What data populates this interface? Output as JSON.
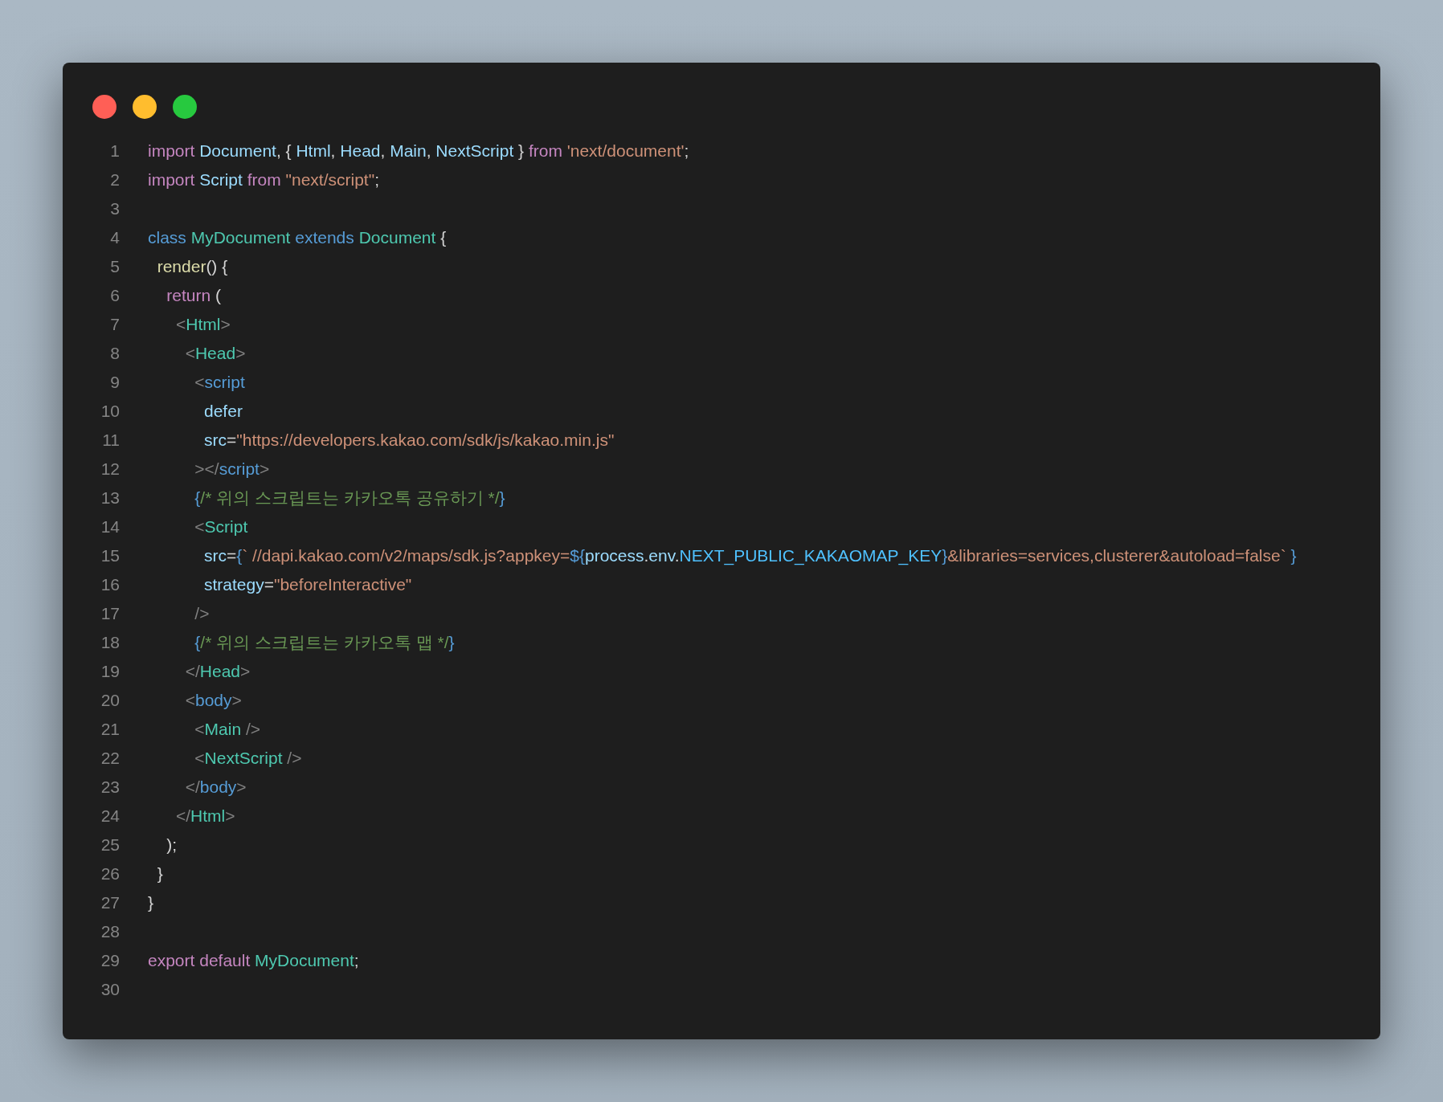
{
  "window": {
    "controls": [
      {
        "kind": "close"
      },
      {
        "kind": "minimize"
      },
      {
        "kind": "zoom"
      }
    ]
  },
  "lines": [
    {
      "number": "1",
      "tokens": [
        {
          "text": "import ",
          "kind": "keyword"
        },
        {
          "text": "Document",
          "kind": "ident"
        },
        {
          "text": ", { ",
          "kind": "plain"
        },
        {
          "text": "Html",
          "kind": "ident"
        },
        {
          "text": ", ",
          "kind": "plain"
        },
        {
          "text": "Head",
          "kind": "ident"
        },
        {
          "text": ", ",
          "kind": "plain"
        },
        {
          "text": "Main",
          "kind": "ident"
        },
        {
          "text": ", ",
          "kind": "plain"
        },
        {
          "text": "NextScript",
          "kind": "ident"
        },
        {
          "text": " } ",
          "kind": "plain"
        },
        {
          "text": "from ",
          "kind": "keyword"
        },
        {
          "text": "'next/document'",
          "kind": "string"
        },
        {
          "text": ";",
          "kind": "plain"
        }
      ]
    },
    {
      "number": "2",
      "tokens": [
        {
          "text": "import ",
          "kind": "keyword"
        },
        {
          "text": "Script ",
          "kind": "ident"
        },
        {
          "text": "from ",
          "kind": "keyword"
        },
        {
          "text": "\"next/script\"",
          "kind": "string"
        },
        {
          "text": ";",
          "kind": "plain"
        }
      ]
    },
    {
      "number": "3"
    },
    {
      "number": "4",
      "tokens": [
        {
          "text": "class ",
          "kind": "storage"
        },
        {
          "text": "MyDocument ",
          "kind": "type"
        },
        {
          "text": "extends ",
          "kind": "storage"
        },
        {
          "text": "Document ",
          "kind": "type"
        },
        {
          "text": "{",
          "kind": "plain"
        }
      ]
    },
    {
      "number": "5",
      "tokens": [
        {
          "text": "  render",
          "kind": "function"
        },
        {
          "text": "() {",
          "kind": "plain"
        }
      ]
    },
    {
      "number": "6",
      "tokens": [
        {
          "text": "    return ",
          "kind": "keyword"
        },
        {
          "text": "(",
          "kind": "plain"
        }
      ]
    },
    {
      "number": "7",
      "tokens": [
        {
          "text": "      <",
          "kind": "punct"
        },
        {
          "text": "Html",
          "kind": "type"
        },
        {
          "text": ">",
          "kind": "punct"
        }
      ]
    },
    {
      "number": "8",
      "tokens": [
        {
          "text": "        <",
          "kind": "punct"
        },
        {
          "text": "Head",
          "kind": "type"
        },
        {
          "text": ">",
          "kind": "punct"
        }
      ]
    },
    {
      "number": "9",
      "tokens": [
        {
          "text": "          <",
          "kind": "punct"
        },
        {
          "text": "script",
          "kind": "storage"
        }
      ]
    },
    {
      "number": "10",
      "tokens": [
        {
          "text": "            defer",
          "kind": "ident"
        }
      ]
    },
    {
      "number": "11",
      "tokens": [
        {
          "text": "            src",
          "kind": "ident"
        },
        {
          "text": "=",
          "kind": "plain"
        },
        {
          "text": "\"https://developers.kakao.com/sdk/js/kakao.min.js\"",
          "kind": "string"
        }
      ]
    },
    {
      "number": "12",
      "tokens": [
        {
          "text": "          ></",
          "kind": "punct"
        },
        {
          "text": "script",
          "kind": "storage"
        },
        {
          "text": ">",
          "kind": "punct"
        }
      ]
    },
    {
      "number": "13",
      "tokens": [
        {
          "text": "          {",
          "kind": "storage"
        },
        {
          "text": "/* 위의 스크립트는 카카오톡 공유하기 */",
          "kind": "comment"
        },
        {
          "text": "}",
          "kind": "storage"
        }
      ]
    },
    {
      "number": "14",
      "tokens": [
        {
          "text": "          <",
          "kind": "punct"
        },
        {
          "text": "Script",
          "kind": "type"
        }
      ]
    },
    {
      "number": "15",
      "tokens": [
        {
          "text": "            src",
          "kind": "ident"
        },
        {
          "text": "=",
          "kind": "plain"
        },
        {
          "text": "{",
          "kind": "storage"
        },
        {
          "text": "` //dapi.kakao.com/v2/maps/sdk.js?appkey=",
          "kind": "string"
        },
        {
          "text": "${",
          "kind": "storage"
        },
        {
          "text": "process",
          "kind": "ident"
        },
        {
          "text": ".",
          "kind": "plain"
        },
        {
          "text": "env",
          "kind": "ident"
        },
        {
          "text": ".",
          "kind": "plain"
        },
        {
          "text": "NEXT_PUBLIC_KAKAOMAP_KEY",
          "kind": "constant"
        },
        {
          "text": "}",
          "kind": "storage"
        },
        {
          "text": "&libraries=services,clusterer&autoload=false`",
          "kind": "string"
        },
        {
          "text": " }",
          "kind": "storage"
        }
      ]
    },
    {
      "number": "16",
      "tokens": [
        {
          "text": "            strategy",
          "kind": "ident"
        },
        {
          "text": "=",
          "kind": "plain"
        },
        {
          "text": "\"beforeInteractive\"",
          "kind": "string"
        }
      ]
    },
    {
      "number": "17",
      "tokens": [
        {
          "text": "          />",
          "kind": "punct"
        }
      ]
    },
    {
      "number": "18",
      "tokens": [
        {
          "text": "          {",
          "kind": "storage"
        },
        {
          "text": "/* 위의 스크립트는 카카오톡 맵 */",
          "kind": "comment"
        },
        {
          "text": "}",
          "kind": "storage"
        }
      ]
    },
    {
      "number": "19",
      "tokens": [
        {
          "text": "        </",
          "kind": "punct"
        },
        {
          "text": "Head",
          "kind": "type"
        },
        {
          "text": ">",
          "kind": "punct"
        }
      ]
    },
    {
      "number": "20",
      "tokens": [
        {
          "text": "        <",
          "kind": "punct"
        },
        {
          "text": "body",
          "kind": "storage"
        },
        {
          "text": ">",
          "kind": "punct"
        }
      ]
    },
    {
      "number": "21",
      "tokens": [
        {
          "text": "          <",
          "kind": "punct"
        },
        {
          "text": "Main ",
          "kind": "type"
        },
        {
          "text": "/>",
          "kind": "punct"
        }
      ]
    },
    {
      "number": "22",
      "tokens": [
        {
          "text": "          <",
          "kind": "punct"
        },
        {
          "text": "NextScript ",
          "kind": "type"
        },
        {
          "text": "/>",
          "kind": "punct"
        }
      ]
    },
    {
      "number": "23",
      "tokens": [
        {
          "text": "        </",
          "kind": "punct"
        },
        {
          "text": "body",
          "kind": "storage"
        },
        {
          "text": ">",
          "kind": "punct"
        }
      ]
    },
    {
      "number": "24",
      "tokens": [
        {
          "text": "      </",
          "kind": "punct"
        },
        {
          "text": "Html",
          "kind": "type"
        },
        {
          "text": ">",
          "kind": "punct"
        }
      ]
    },
    {
      "number": "25",
      "tokens": [
        {
          "text": "    );",
          "kind": "plain"
        }
      ]
    },
    {
      "number": "26",
      "tokens": [
        {
          "text": "  }",
          "kind": "plain"
        }
      ]
    },
    {
      "number": "27",
      "tokens": [
        {
          "text": "}",
          "kind": "plain"
        }
      ]
    },
    {
      "number": "28"
    },
    {
      "number": "29",
      "tokens": [
        {
          "text": "export ",
          "kind": "keyword"
        },
        {
          "text": "default ",
          "kind": "keyword"
        },
        {
          "text": "MyDocument",
          "kind": "type"
        },
        {
          "text": ";",
          "kind": "plain"
        }
      ]
    },
    {
      "number": "30"
    }
  ]
}
